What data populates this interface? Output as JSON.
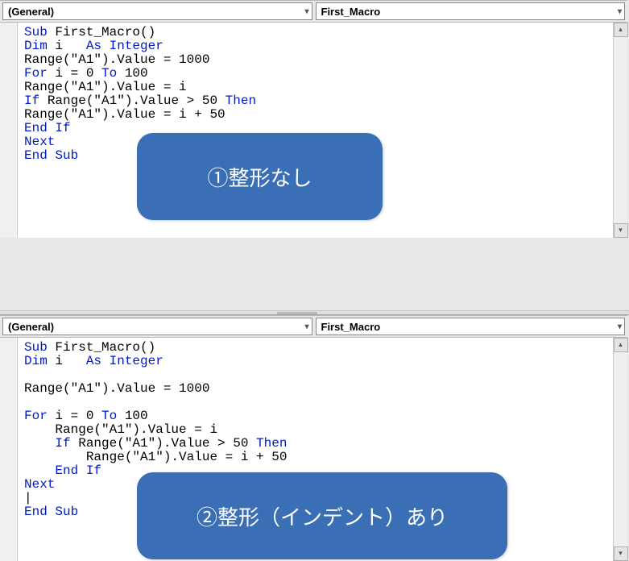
{
  "panel1": {
    "dropdown_object": "(General)",
    "dropdown_proc": "First_Macro",
    "callout": "①整形なし",
    "code": [
      {
        "segs": [
          {
            "t": "Sub ",
            "c": "kw"
          },
          {
            "t": "First_Macro()"
          }
        ]
      },
      {
        "segs": [
          {
            "t": "Dim ",
            "c": "kw"
          },
          {
            "t": "i   "
          },
          {
            "t": "As Integer",
            "c": "kw"
          }
        ]
      },
      {
        "segs": [
          {
            "t": "Range(\"A1\").Value = 1000"
          }
        ]
      },
      {
        "segs": [
          {
            "t": "For ",
            "c": "kw"
          },
          {
            "t": "i = 0 "
          },
          {
            "t": "To ",
            "c": "kw"
          },
          {
            "t": "100"
          }
        ]
      },
      {
        "segs": [
          {
            "t": "Range(\"A1\").Value = i"
          }
        ]
      },
      {
        "segs": [
          {
            "t": "If ",
            "c": "kw"
          },
          {
            "t": "Range(\"A1\").Value > 50 "
          },
          {
            "t": "Then",
            "c": "kw"
          }
        ]
      },
      {
        "segs": [
          {
            "t": "Range(\"A1\").Value = i + 50"
          }
        ]
      },
      {
        "segs": [
          {
            "t": "End If",
            "c": "kw"
          }
        ]
      },
      {
        "segs": [
          {
            "t": "Next",
            "c": "kw"
          }
        ]
      },
      {
        "segs": [
          {
            "t": "End Sub",
            "c": "kw"
          }
        ]
      }
    ]
  },
  "panel2": {
    "dropdown_object": "(General)",
    "dropdown_proc": "First_Macro",
    "callout": "②整形（インデント）あり",
    "code": [
      {
        "segs": [
          {
            "t": "Sub ",
            "c": "kw"
          },
          {
            "t": "First_Macro()"
          }
        ]
      },
      {
        "segs": [
          {
            "t": "Dim ",
            "c": "kw"
          },
          {
            "t": "i   "
          },
          {
            "t": "As Integer",
            "c": "kw"
          }
        ]
      },
      {
        "segs": [
          {
            "t": ""
          }
        ]
      },
      {
        "segs": [
          {
            "t": "Range(\"A1\").Value = 1000"
          }
        ]
      },
      {
        "segs": [
          {
            "t": ""
          }
        ]
      },
      {
        "segs": [
          {
            "t": "For ",
            "c": "kw"
          },
          {
            "t": "i = 0 "
          },
          {
            "t": "To ",
            "c": "kw"
          },
          {
            "t": "100"
          }
        ]
      },
      {
        "segs": [
          {
            "t": "    Range(\"A1\").Value = i"
          }
        ]
      },
      {
        "segs": [
          {
            "t": "    "
          },
          {
            "t": "If ",
            "c": "kw"
          },
          {
            "t": "Range(\"A1\").Value > 50 "
          },
          {
            "t": "Then",
            "c": "kw"
          }
        ]
      },
      {
        "segs": [
          {
            "t": "        Range(\"A1\").Value = i + 50"
          }
        ]
      },
      {
        "segs": [
          {
            "t": "    "
          },
          {
            "t": "End If",
            "c": "kw"
          }
        ]
      },
      {
        "segs": [
          {
            "t": "Next",
            "c": "kw"
          }
        ]
      },
      {
        "segs": [
          {
            "t": "|"
          }
        ]
      },
      {
        "segs": [
          {
            "t": "End Sub",
            "c": "kw"
          }
        ]
      }
    ]
  }
}
